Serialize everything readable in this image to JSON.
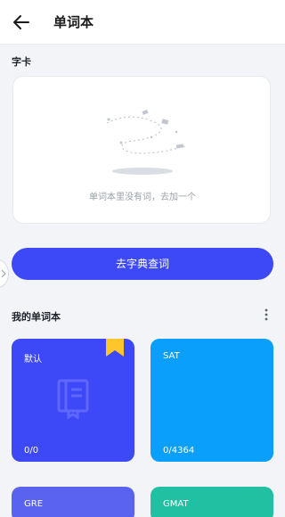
{
  "header": {
    "title": "单词本",
    "back_icon": "arrow-left-icon"
  },
  "card_section": {
    "label": "字卡",
    "empty_text": "单词本里没有词，去加一个"
  },
  "dictionary_button": {
    "label": "去字典查词"
  },
  "my_books": {
    "label": "我的单词本",
    "more_icon": "more-vertical-icon",
    "books": [
      {
        "name": "默认",
        "count": "0/0",
        "color": "#3d48f7",
        "bookmark": true
      },
      {
        "name": "SAT",
        "count": "0/4364",
        "color": "#0a9ffb"
      },
      {
        "name": "GRE",
        "color": "#5a63f0"
      },
      {
        "name": "GMAT",
        "color": "#22c0a3"
      }
    ]
  }
}
